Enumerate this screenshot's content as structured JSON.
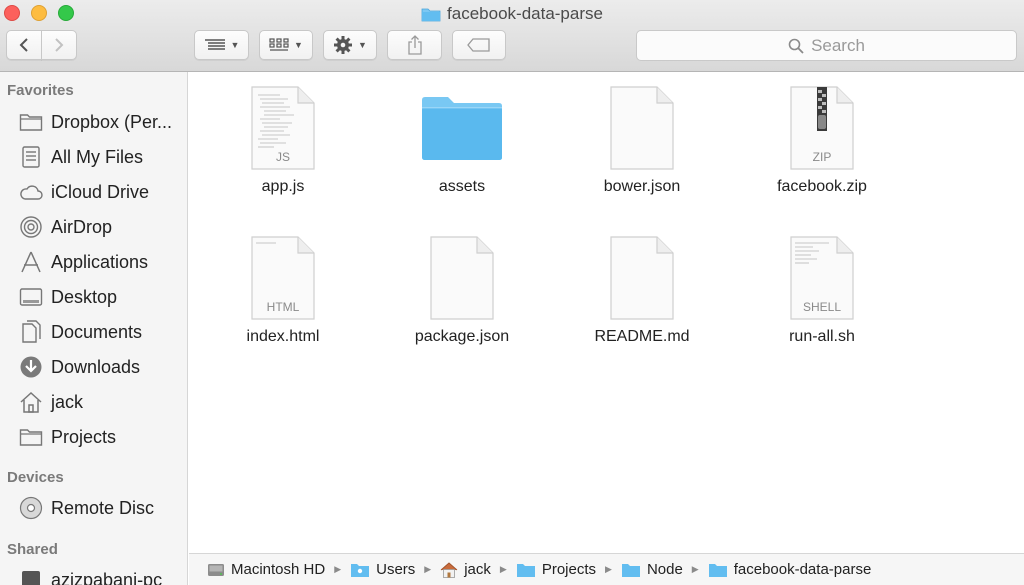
{
  "window": {
    "title": "facebook-data-parse"
  },
  "toolbar": {
    "search_label": "Search"
  },
  "sidebar": {
    "sections": [
      {
        "heading": "Favorites",
        "items": [
          {
            "label": "Dropbox (Per...",
            "icon": "folder-icon"
          },
          {
            "label": "All My Files",
            "icon": "all-files-icon"
          },
          {
            "label": "iCloud Drive",
            "icon": "cloud-icon"
          },
          {
            "label": "AirDrop",
            "icon": "airdrop-icon"
          },
          {
            "label": "Applications",
            "icon": "applications-icon"
          },
          {
            "label": "Desktop",
            "icon": "desktop-icon"
          },
          {
            "label": "Documents",
            "icon": "documents-icon"
          },
          {
            "label": "Downloads",
            "icon": "downloads-icon"
          },
          {
            "label": "jack",
            "icon": "home-icon"
          },
          {
            "label": "Projects",
            "icon": "folder-icon"
          }
        ]
      },
      {
        "heading": "Devices",
        "items": [
          {
            "label": "Remote Disc",
            "icon": "disc-icon"
          }
        ]
      },
      {
        "heading": "Shared",
        "items": [
          {
            "label": "azizpabani-pc",
            "icon": "pc-icon"
          }
        ]
      }
    ]
  },
  "files": [
    {
      "name": "app.js",
      "kind": "JS"
    },
    {
      "name": "assets",
      "kind": "folder"
    },
    {
      "name": "bower.json",
      "kind": ""
    },
    {
      "name": "facebook.zip",
      "kind": "ZIP"
    },
    {
      "name": "index.html",
      "kind": "HTML"
    },
    {
      "name": "package.json",
      "kind": ""
    },
    {
      "name": "README.md",
      "kind": ""
    },
    {
      "name": "run-all.sh",
      "kind": "SHELL"
    }
  ],
  "pathbar": [
    {
      "label": "Macintosh HD",
      "icon": "hard-drive-icon"
    },
    {
      "label": "Users",
      "icon": "users-folder-icon"
    },
    {
      "label": "jack",
      "icon": "home-icon"
    },
    {
      "label": "Projects",
      "icon": "folder-icon"
    },
    {
      "label": "Node",
      "icon": "folder-icon"
    },
    {
      "label": "facebook-data-parse",
      "icon": "folder-icon"
    }
  ],
  "colors": {
    "folder_blue": "#5ab9ee",
    "close": "#fc605c",
    "minimize": "#fdbc40",
    "maximize": "#34c84a"
  }
}
